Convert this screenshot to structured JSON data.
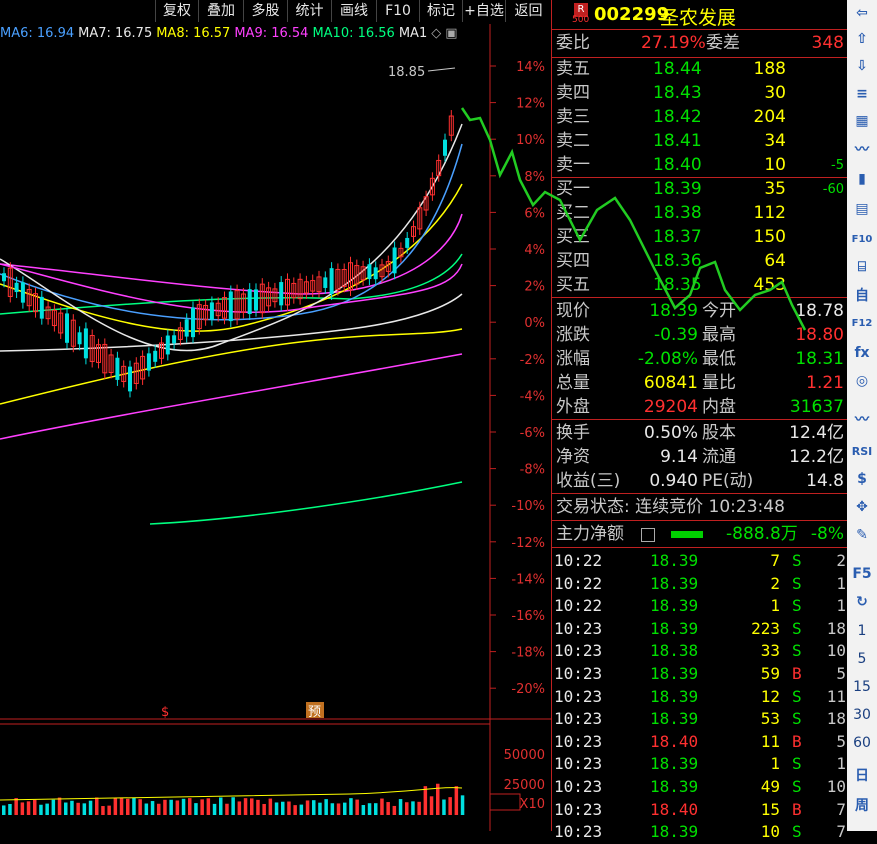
{
  "toolbar": [
    "复权",
    "叠加",
    "多股",
    "统计",
    "画线",
    "F10",
    "标记",
    "+自选",
    "返回"
  ],
  "ma_legend": [
    {
      "label": "MA6: 16.94",
      "color": "#4aa0ff"
    },
    {
      "label": "MA7: 16.75",
      "color": "#e8e8e8"
    },
    {
      "label": "MA8: 16.57",
      "color": "#ffff00"
    },
    {
      "label": "MA9: 16.54",
      "color": "#ff40ff"
    },
    {
      "label": "MA10: 16.56",
      "color": "#00ff80"
    },
    {
      "label": "MA1",
      "color": "#e8e8e8"
    }
  ],
  "high_marker": "18.85",
  "pct_axis": [
    "14%",
    "12%",
    "10%",
    "8%",
    "6%",
    "4%",
    "2%",
    "0%",
    "-2%",
    "-4%",
    "-6%",
    "-8%",
    "-10%",
    "-12%",
    "-14%",
    "-16%",
    "-18%",
    "-20%"
  ],
  "volume_axis": [
    "50000",
    "25000",
    "X10"
  ],
  "chart_markers": {
    "s_marker": "$",
    "yu_marker": "预"
  },
  "stock": {
    "r_badge": "R",
    "r_num": "500",
    "code": "002299",
    "name": "圣农发展"
  },
  "weibi": {
    "label1": "委比",
    "value1": "27.19%",
    "label2": "委差",
    "value2": "348"
  },
  "asks": [
    {
      "label": "卖五",
      "price": "18.44",
      "vol": "188",
      "chg": ""
    },
    {
      "label": "卖四",
      "price": "18.43",
      "vol": "30",
      "chg": ""
    },
    {
      "label": "卖三",
      "price": "18.42",
      "vol": "204",
      "chg": ""
    },
    {
      "label": "卖二",
      "price": "18.41",
      "vol": "34",
      "chg": ""
    },
    {
      "label": "卖一",
      "price": "18.40",
      "vol": "10",
      "chg": "-5"
    }
  ],
  "bids": [
    {
      "label": "买一",
      "price": "18.39",
      "vol": "35",
      "chg": "-60"
    },
    {
      "label": "买二",
      "price": "18.38",
      "vol": "112",
      "chg": ""
    },
    {
      "label": "买三",
      "price": "18.37",
      "vol": "150",
      "chg": ""
    },
    {
      "label": "买四",
      "price": "18.36",
      "vol": "64",
      "chg": ""
    },
    {
      "label": "买五",
      "price": "18.35",
      "vol": "453",
      "chg": ""
    }
  ],
  "quote": [
    {
      "l1": "现价",
      "v1": "18.39",
      "c1": "grn",
      "l2": "今开",
      "v2": "18.78",
      "c2": "wht"
    },
    {
      "l1": "涨跌",
      "v1": "-0.39",
      "c1": "grn",
      "l2": "最高",
      "v2": "18.80",
      "c2": "red"
    },
    {
      "l1": "涨幅",
      "v1": "-2.08%",
      "c1": "grn",
      "l2": "最低",
      "v2": "18.31",
      "c2": "grn"
    },
    {
      "l1": "总量",
      "v1": "60841",
      "c1": "yel",
      "l2": "量比",
      "v2": "1.21",
      "c2": "red"
    },
    {
      "l1": "外盘",
      "v1": "29204",
      "c1": "red",
      "l2": "内盘",
      "v2": "31637",
      "c2": "grn"
    }
  ],
  "fund": [
    {
      "l1": "换手",
      "v1": "0.50%",
      "l2": "股本",
      "v2": "12.4亿"
    },
    {
      "l1": "净资",
      "v1": "9.14",
      "l2": "流通",
      "v2": "12.2亿"
    },
    {
      "l1": "收益(三)",
      "v1": "0.940",
      "l2": "PE(动)",
      "v2": "14.8"
    }
  ],
  "trade_status": "交易状态: 连续竞价 10:23:48",
  "main_flow": {
    "label": "主力净额",
    "value": "-888.8万",
    "pct": "-8%"
  },
  "ticks": [
    {
      "t": "10:22",
      "p": "18.39",
      "v": "7",
      "s": "S",
      "n": "2"
    },
    {
      "t": "10:22",
      "p": "18.39",
      "v": "2",
      "s": "S",
      "n": "1"
    },
    {
      "t": "10:22",
      "p": "18.39",
      "v": "1",
      "s": "S",
      "n": "1"
    },
    {
      "t": "10:23",
      "p": "18.39",
      "v": "223",
      "s": "S",
      "n": "18"
    },
    {
      "t": "10:23",
      "p": "18.38",
      "v": "33",
      "s": "S",
      "n": "10"
    },
    {
      "t": "10:23",
      "p": "18.39",
      "v": "59",
      "s": "B",
      "n": "5"
    },
    {
      "t": "10:23",
      "p": "18.39",
      "v": "12",
      "s": "S",
      "n": "11"
    },
    {
      "t": "10:23",
      "p": "18.39",
      "v": "53",
      "s": "S",
      "n": "18"
    },
    {
      "t": "10:23",
      "p": "18.40",
      "v": "11",
      "s": "B",
      "n": "5"
    },
    {
      "t": "10:23",
      "p": "18.39",
      "v": "1",
      "s": "S",
      "n": "1"
    },
    {
      "t": "10:23",
      "p": "18.39",
      "v": "49",
      "s": "S",
      "n": "10"
    },
    {
      "t": "10:23",
      "p": "18.40",
      "v": "15",
      "s": "B",
      "n": "7"
    },
    {
      "t": "10:23",
      "p": "18.39",
      "v": "10",
      "s": "S",
      "n": "7"
    }
  ],
  "side_tools": [
    "⇦",
    "⇧",
    "⇩",
    "≡",
    "▦",
    "〰",
    "▮",
    "▤",
    "F10",
    "⌸",
    "自",
    "F12",
    "fx",
    "◎",
    "〰",
    "RSI",
    "$",
    "✥",
    "✎",
    "F5",
    "↻",
    "1",
    "5",
    "15",
    "30",
    "60",
    "日",
    "周"
  ]
}
